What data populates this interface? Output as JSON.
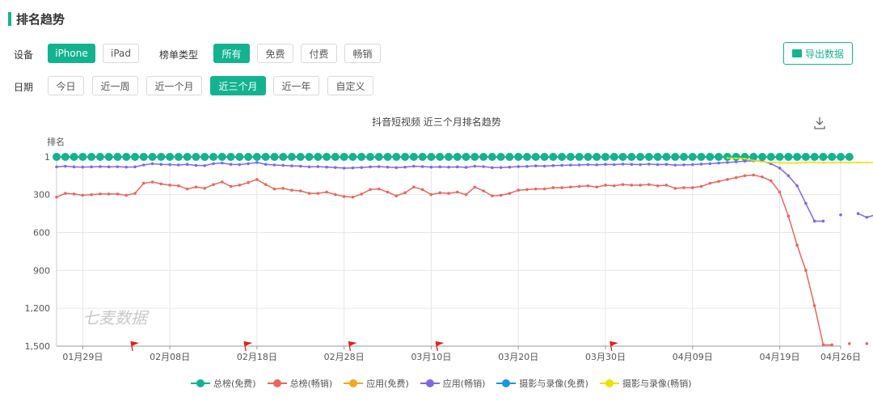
{
  "section_title": "排名趋势",
  "filters": {
    "device_label": "设备",
    "devices": [
      "iPhone",
      "iPad"
    ],
    "device_active": "iPhone",
    "list_type_label": "榜单类型",
    "list_types": [
      "所有",
      "免费",
      "付费",
      "畅销"
    ],
    "list_type_active": "所有",
    "date_label": "日期",
    "dates": [
      "今日",
      "近一周",
      "近一个月",
      "近三个月",
      "近一年",
      "自定义"
    ],
    "date_active": "近三个月"
  },
  "export_label": "导出数据",
  "icons": {
    "export": "folder-export-icon",
    "download": "download-icon"
  },
  "colors": {
    "accent": "#13b38f",
    "总榜(免费)": "#13b38f",
    "总榜(畅销)": "#e8675c",
    "应用(免费)": "#f5a623",
    "应用(畅销)": "#7b6ae6",
    "摄影与录像(免费)": "#1a98e0",
    "摄影与录像(畅销)": "#f0e000"
  },
  "watermark": "七麦数据",
  "chart_data": {
    "type": "line",
    "title": "抖音短视频 近三个月排名趋势",
    "ylabel": "排名",
    "y_inverted": true,
    "ylim": [
      1,
      1500
    ],
    "y_ticks": [
      1,
      300,
      600,
      900,
      1200,
      1500
    ],
    "y_tick_labels": [
      "1",
      "300",
      "600",
      "900",
      "1,200",
      "1,500"
    ],
    "x_range": [
      "01月26日",
      "04月26日"
    ],
    "x_ticks": [
      "01月29日",
      "02月08日",
      "02月18日",
      "02月28日",
      "03月10日",
      "03月20日",
      "03月30日",
      "04月09日",
      "04月19日",
      "04月26日"
    ],
    "grid": true,
    "legend_position": "bottom",
    "series": [
      {
        "name": "总榜(免费)",
        "start_day": 0,
        "values": [
          1,
          1,
          1,
          1,
          1,
          1,
          1,
          1,
          1,
          1,
          1,
          1,
          1,
          1,
          1,
          1,
          1,
          1,
          1,
          1,
          1,
          1,
          1,
          1,
          1,
          1,
          1,
          1,
          1,
          1,
          1,
          1,
          1,
          1,
          1,
          1,
          1,
          1,
          1,
          1,
          1,
          1,
          1,
          1,
          1,
          1,
          1,
          1,
          1,
          1,
          1,
          1,
          1,
          1,
          1,
          1,
          1,
          1,
          1,
          1,
          1,
          1,
          1,
          1,
          1,
          1,
          1,
          1,
          1,
          1,
          1,
          1,
          1,
          1,
          1,
          1,
          1,
          1,
          1,
          1,
          1,
          1,
          1,
          1,
          1,
          1,
          1,
          1,
          1,
          1,
          1,
          1
        ]
      },
      {
        "name": "总榜(畅销)",
        "start_day": 0,
        "values": [
          320,
          290,
          295,
          305,
          300,
          295,
          295,
          295,
          305,
          290,
          210,
          200,
          215,
          225,
          230,
          255,
          240,
          250,
          220,
          200,
          235,
          225,
          205,
          180,
          220,
          255,
          250,
          265,
          270,
          290,
          290,
          280,
          300,
          315,
          320,
          295,
          260,
          255,
          280,
          310,
          285,
          240,
          260,
          300,
          285,
          290,
          280,
          300,
          240,
          270,
          310,
          305,
          290,
          265,
          260,
          255,
          255,
          245,
          245,
          240,
          235,
          230,
          240,
          225,
          230,
          220,
          225,
          225,
          220,
          230,
          225,
          250,
          245,
          245,
          235,
          210,
          195,
          180,
          165,
          150,
          145,
          160,
          190,
          280,
          470,
          700,
          900,
          1180,
          1490,
          1490,
          null,
          1480,
          null,
          1480,
          1540,
          1450,
          1540
        ]
      },
      {
        "name": "应用(畅销)",
        "start_day": 0,
        "values": [
          80,
          75,
          80,
          82,
          80,
          78,
          80,
          79,
          82,
          80,
          65,
          55,
          60,
          62,
          65,
          60,
          68,
          70,
          55,
          50,
          60,
          62,
          55,
          45,
          60,
          65,
          68,
          72,
          75,
          80,
          78,
          82,
          85,
          90,
          88,
          85,
          80,
          78,
          82,
          86,
          82,
          75,
          78,
          82,
          80,
          82,
          80,
          84,
          75,
          78,
          86,
          85,
          82,
          78,
          76,
          72,
          74,
          70,
          68,
          66,
          65,
          62,
          64,
          60,
          62,
          58,
          60,
          62,
          58,
          62,
          60,
          66,
          64,
          62,
          58,
          55,
          50,
          45,
          40,
          35,
          32,
          35,
          55,
          90,
          150,
          230,
          370,
          510,
          510,
          null,
          460,
          null,
          450,
          480,
          460,
          520
        ]
      },
      {
        "name": "摄影与录像(畅销)",
        "start_day": 77,
        "values": [
          10,
          12,
          15,
          30,
          40,
          45,
          48,
          50,
          50,
          45,
          45,
          48,
          46,
          45,
          47,
          45,
          46,
          45,
          44,
          45
        ]
      }
    ]
  }
}
